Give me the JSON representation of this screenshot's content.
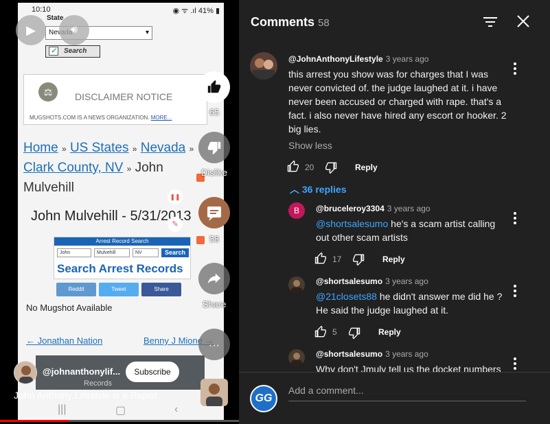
{
  "phone": {
    "time": "10:10",
    "status_right": "◉ ᯤ .ıl 41% ▮",
    "state_label": "State",
    "state_value": "Nevada",
    "search_label": "Search"
  },
  "site": {
    "disclaimer_title": "DISCLAIMER NOTICE",
    "disclaimer_body": "MUGSHOTS.COM IS A NEWS ORGANIZATION.",
    "disclaimer_more": "MORE...",
    "breadcrumb": {
      "home": "Home",
      "states": "US States",
      "nevada": "Nevada",
      "county": "Clark County, NV",
      "name": "John Mulvehill",
      "sep": "»"
    },
    "person_title": "John Mulvehill - 5/31/2013",
    "arrest_widget": {
      "header": "Arrest Record Search",
      "first": "John",
      "last": "Mulvehill",
      "state": "NV",
      "button": "Search",
      "big_text": "Search Arrest Records"
    },
    "share": {
      "reddit": "Reddit",
      "tweet": "Tweet",
      "facebook": "Share"
    },
    "no_mugshot": "No Mugshot Available",
    "prev_link": "← Jonathan Nation",
    "next_link": "Benny J Mione →",
    "records_label": "Records"
  },
  "video_actions": {
    "like_count": "65",
    "dislike_label": "Dislike",
    "comments_count": "58",
    "share_label": "Share"
  },
  "channel": {
    "name": "@johnanthonylif...",
    "subscribe_label": "Subscribe",
    "video_title": "John Anthony Lifestyle is a Rapist",
    "progress": 0.29
  },
  "comments_panel": {
    "title": "Comments",
    "count": "58",
    "add_placeholder": "Add a comment...",
    "user_initials": "GG",
    "show_less": "Show less",
    "replies_toggle": "36 replies",
    "top_comment": {
      "handle": "@JohnAnthonyLifestyle",
      "time": "3 years ago",
      "text": "this arrest you show was for charges that I was never convicted of. the judge laughed at it. i have never been accused or charged with rape. that's a fact. i also never have hired any escort or hooker. 2 big lies.",
      "likes": "20",
      "reply_label": "Reply"
    },
    "replies": [
      {
        "handle": "@bruceleroy3304",
        "time": "3 years ago",
        "avatar_letter": "B",
        "mention": "@shortsalesumo",
        "text": " he's a scam artist calling out other scam artists",
        "likes": "17",
        "reply_label": "Reply"
      },
      {
        "handle": "@shortsalesumo",
        "time": "3 years ago",
        "mention": "@21closets88",
        "text": " he didn't answer me did he ? He said the judge laughed at it.",
        "likes": "5",
        "reply_label": "Reply"
      },
      {
        "handle": "@shortsalesumo",
        "time": "3 years ago",
        "text": "Why don't Jmuly tell us the docket numbers"
      }
    ]
  },
  "colors": {
    "panel_bg": "#212121",
    "link_blue": "#3ea6ff",
    "progress_red": "#ff0000",
    "site_link": "#1d6fb8"
  }
}
